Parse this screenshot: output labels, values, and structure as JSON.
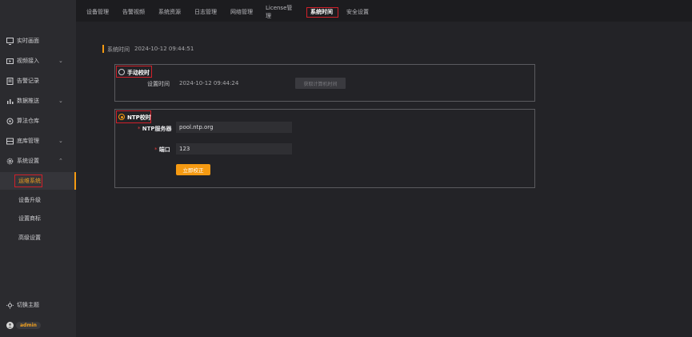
{
  "topnav": {
    "tabs": [
      {
        "label": "设备管理"
      },
      {
        "label": "告警视频"
      },
      {
        "label": "系统资源"
      },
      {
        "label": "日志管理"
      },
      {
        "label": "网络管理"
      },
      {
        "label": "License管理"
      },
      {
        "label": "系统时间"
      },
      {
        "label": "安全设置"
      }
    ],
    "active_index": 6
  },
  "sidebar": {
    "items": [
      {
        "label": "实时画面",
        "icon": "monitor-icon"
      },
      {
        "label": "视频接入",
        "icon": "video-input-icon",
        "expandable": true
      },
      {
        "label": "告警记录",
        "icon": "alarm-record-icon"
      },
      {
        "label": "数据推送",
        "icon": "bar-chart-icon",
        "expandable": true
      },
      {
        "label": "算法仓库",
        "icon": "algorithm-icon"
      },
      {
        "label": "底库管理",
        "icon": "database-icon",
        "expandable": true
      },
      {
        "label": "系统设置",
        "icon": "gear-icon",
        "expanded": true
      }
    ],
    "sub_items": [
      {
        "label": "运维系统",
        "active": true
      },
      {
        "label": "设备升级"
      },
      {
        "label": "设置商标"
      },
      {
        "label": "高级设置"
      }
    ],
    "theme_toggle": "切换主题",
    "user": "admin"
  },
  "main": {
    "system_time_label": "系统时间",
    "system_time_value": "2024-10-12 09:44:51",
    "manual": {
      "radio_label": "手动校时",
      "checked": false,
      "set_time_label": "设置时间",
      "set_time_value": "2024-10-12 09:44:24",
      "get_pc_time_button": "获取计算机时间"
    },
    "ntp": {
      "radio_label": "NTP校时",
      "checked": true,
      "server_label": "NTP服务器",
      "server_value": "pool.ntp.org",
      "port_label": "端口",
      "port_value": "123",
      "calibrate_button": "立即校正"
    }
  },
  "colors": {
    "accent": "#f59a12",
    "highlight_box": "#d0202a",
    "background": "#232327",
    "sidebar": "#2b2b2f"
  }
}
